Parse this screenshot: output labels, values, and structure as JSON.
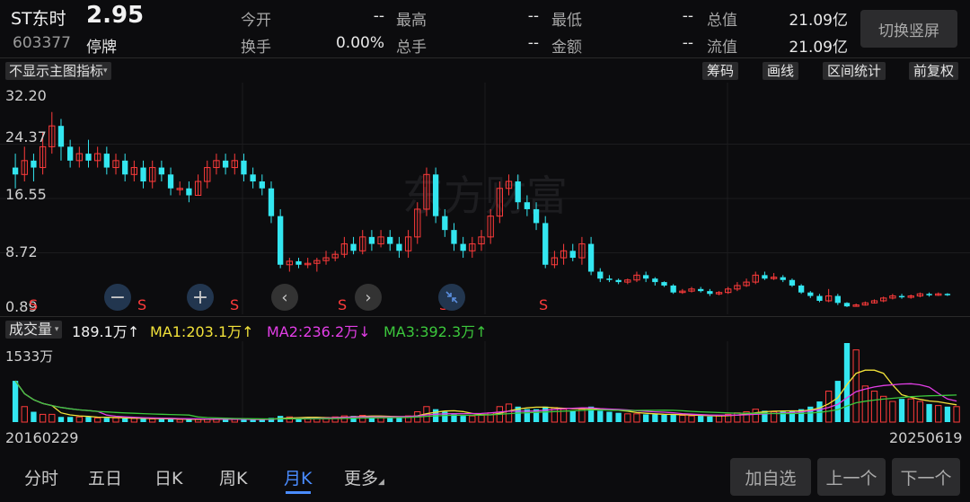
{
  "stock": {
    "name": "ST东时",
    "price": "2.95",
    "code": "603377",
    "status": "停牌"
  },
  "quote": [
    {
      "label": "今开",
      "value": "--"
    },
    {
      "label": "最高",
      "value": "--"
    },
    {
      "label": "最低",
      "value": "--"
    },
    {
      "label": "总值",
      "value": "21.09亿"
    },
    {
      "label": "换手",
      "value": "0.00%"
    },
    {
      "label": "总手",
      "value": "--"
    },
    {
      "label": "金额",
      "value": "--"
    },
    {
      "label": "流值",
      "value": "21.09亿"
    }
  ],
  "switch_vertical": "切换竖屏",
  "toolbar": {
    "main_indicator": "不显示主图指标",
    "chips": "筹码",
    "draw": "画线",
    "range_stats": "区间统计",
    "adjust": "前复权"
  },
  "price_axis": [
    "32.20",
    "24.37",
    "16.55",
    "8.72",
    "0.89"
  ],
  "watermark": "东方财富",
  "markers": [
    "S",
    "S",
    "S",
    "S",
    "S",
    "S"
  ],
  "volume": {
    "indicator": "成交量",
    "current": "189.1万",
    "ma1": "MA1:203.1万",
    "ma2": "MA2:236.2万",
    "ma3": "MA3:392.3万",
    "arrow_up": "↑",
    "arrow_down": "↓",
    "max_label": "1533万"
  },
  "dates": {
    "start": "20160229",
    "end": "20250619"
  },
  "nav": [
    "分时",
    "五日",
    "日K",
    "周K",
    "月K",
    "更多"
  ],
  "nav_active_index": 4,
  "bottom_buttons": {
    "add": "加自选",
    "prev": "上一个",
    "next": "下一个"
  },
  "colors": {
    "up": "#ff3b3b",
    "down": "#33e6f0",
    "ma1": "#f2e23a",
    "ma2": "#e23ee6",
    "ma3": "#3cc83c",
    "accent": "#4a8cff"
  },
  "chart_data": {
    "type": "candlestick",
    "y_axis_ticks": [
      "32.20",
      "24.37",
      "16.55",
      "8.72",
      "0.89"
    ],
    "ylim": [
      0.89,
      32.2
    ],
    "x_range": [
      "20160229",
      "20250619"
    ],
    "volume_max": "1533万",
    "candles": [
      [
        21,
        20,
        23,
        18
      ],
      [
        20,
        22,
        24,
        19
      ],
      [
        22,
        21,
        23,
        19
      ],
      [
        21,
        24,
        26,
        20
      ],
      [
        24,
        27,
        29,
        23
      ],
      [
        27,
        24,
        28,
        22
      ],
      [
        24,
        22,
        25,
        21
      ],
      [
        22,
        23,
        24,
        21
      ],
      [
        23,
        22,
        25,
        21
      ],
      [
        22,
        23,
        24,
        21
      ],
      [
        23,
        21,
        24,
        20
      ],
      [
        21,
        22,
        23,
        20
      ],
      [
        22,
        20,
        23,
        19
      ],
      [
        20,
        21,
        22,
        19
      ],
      [
        21,
        19,
        22,
        18
      ],
      [
        19,
        21,
        22,
        18
      ],
      [
        21,
        20,
        22,
        19
      ],
      [
        20,
        18,
        21,
        17
      ],
      [
        18,
        18,
        19,
        17
      ],
      [
        18,
        17,
        19,
        16
      ],
      [
        17,
        19,
        20,
        17
      ],
      [
        19,
        21,
        22,
        18
      ],
      [
        21,
        22,
        23,
        20
      ],
      [
        22,
        21,
        23,
        20
      ],
      [
        21,
        22,
        23,
        20
      ],
      [
        22,
        20,
        23,
        19
      ],
      [
        20,
        19,
        21,
        18
      ],
      [
        19,
        18,
        20,
        17
      ],
      [
        18,
        14,
        19,
        13
      ],
      [
        14,
        7,
        15,
        6.5
      ],
      [
        7,
        7.5,
        8,
        6
      ],
      [
        7.5,
        7,
        8,
        6.5
      ],
      [
        7,
        7.2,
        8,
        6.5
      ],
      [
        7.2,
        7.6,
        8,
        6
      ],
      [
        7.6,
        8,
        9,
        7
      ],
      [
        8,
        8.5,
        9,
        7.5
      ],
      [
        8.5,
        10,
        11,
        8
      ],
      [
        10,
        9,
        11,
        8.5
      ],
      [
        9,
        11,
        12,
        8.5
      ],
      [
        11,
        10,
        12,
        9
      ],
      [
        10,
        11,
        12,
        9.5
      ],
      [
        11,
        10,
        12,
        9
      ],
      [
        10,
        9,
        11,
        8
      ],
      [
        9,
        11,
        12,
        8
      ],
      [
        11,
        15,
        16,
        10
      ],
      [
        15,
        20,
        21,
        14
      ],
      [
        20,
        14,
        21,
        13
      ],
      [
        14,
        12,
        15,
        11
      ],
      [
        12,
        10,
        13,
        9
      ],
      [
        10,
        9,
        11,
        8
      ],
      [
        9,
        10,
        11,
        8
      ],
      [
        10,
        11,
        12,
        9
      ],
      [
        11,
        14,
        15,
        10
      ],
      [
        14,
        18,
        19,
        13
      ],
      [
        18,
        19,
        20,
        17
      ],
      [
        19,
        16,
        20,
        15
      ],
      [
        16,
        15,
        17,
        14
      ],
      [
        15,
        13,
        16,
        12
      ],
      [
        13,
        7,
        14,
        6.5
      ],
      [
        7,
        8,
        9,
        6.5
      ],
      [
        8,
        9,
        10,
        7
      ],
      [
        9,
        8,
        10,
        7.5
      ],
      [
        8,
        10,
        11,
        7
      ],
      [
        10,
        6,
        11,
        5.5
      ],
      [
        6,
        5,
        6.5,
        4.5
      ],
      [
        5,
        4.8,
        5.5,
        4.5
      ],
      [
        4.8,
        4.5,
        5,
        4.2
      ],
      [
        4.5,
        4.8,
        5,
        4.2
      ],
      [
        4.8,
        5.5,
        6,
        4.5
      ],
      [
        5.5,
        5,
        6,
        4.5
      ],
      [
        5,
        4.5,
        5.2,
        4
      ],
      [
        4.5,
        4,
        4.6,
        3.8
      ],
      [
        4,
        3,
        4.2,
        2.8
      ],
      [
        3,
        3.2,
        3.5,
        2.8
      ],
      [
        3.2,
        3.5,
        3.8,
        3
      ],
      [
        3.5,
        3.2,
        3.8,
        3
      ],
      [
        3.2,
        2.8,
        3.5,
        2.5
      ],
      [
        2.8,
        3,
        3.2,
        2.6
      ],
      [
        3,
        3.5,
        3.8,
        2.8
      ],
      [
        3.5,
        4,
        4.5,
        3.2
      ],
      [
        4,
        4.5,
        5,
        3.8
      ],
      [
        4.5,
        5.5,
        6,
        4.2
      ],
      [
        5.5,
        5,
        6,
        4.8
      ],
      [
        5,
        5.2,
        5.8,
        4.8
      ],
      [
        5.2,
        4.8,
        5.5,
        4.5
      ],
      [
        4.8,
        4,
        5,
        3.8
      ],
      [
        4,
        3,
        4.2,
        2.8
      ],
      [
        3,
        2.5,
        3.2,
        2.2
      ],
      [
        2.5,
        1.8,
        2.8,
        1.6
      ],
      [
        1.8,
        2.5,
        3.5,
        1.6
      ],
      [
        2.5,
        1.5,
        2.8,
        1.2
      ],
      [
        1.5,
        1,
        1.6,
        0.9
      ],
      [
        1,
        1.2,
        1.4,
        0.95
      ],
      [
        1.2,
        1.5,
        1.7,
        1.1
      ],
      [
        1.5,
        1.8,
        2,
        1.4
      ],
      [
        1.8,
        2.2,
        2.4,
        1.6
      ],
      [
        2.2,
        2.5,
        2.8,
        2
      ],
      [
        2.5,
        2.3,
        2.8,
        2.1
      ],
      [
        2.3,
        2.5,
        2.7,
        2.1
      ],
      [
        2.5,
        2.8,
        3,
        2.3
      ],
      [
        2.8,
        2.6,
        3,
        2.4
      ],
      [
        2.6,
        2.8,
        3,
        2.5
      ],
      [
        2.8,
        2.7,
        2.9,
        2.5
      ]
    ],
    "volumes": [
      8,
      3,
      2,
      1.5,
      1.5,
      1,
      1,
      1,
      1,
      0.8,
      0.8,
      0.8,
      0.7,
      0.7,
      0.7,
      0.6,
      0.6,
      0.6,
      0.5,
      0.5,
      0.5,
      0.6,
      0.6,
      0.5,
      0.5,
      0.5,
      0.5,
      0.5,
      0.8,
      1.2,
      1,
      0.8,
      0.8,
      0.8,
      0.9,
      1,
      1.2,
      1.2,
      1.3,
      1.1,
      1,
      1,
      0.9,
      1.2,
      2,
      3,
      2.5,
      2,
      1.5,
      1.2,
      1.2,
      1.3,
      1.8,
      3,
      3.5,
      3,
      2.5,
      2.5,
      3,
      2.8,
      2.5,
      2.2,
      2.5,
      3,
      2.2,
      2,
      1.8,
      1.6,
      1.6,
      1.5,
      1.5,
      1.4,
      1.4,
      1.3,
      1.2,
      1.2,
      1.1,
      1.2,
      1.5,
      1.8,
      2,
      2.5,
      2.2,
      2,
      2,
      2.2,
      2.5,
      3,
      4,
      6,
      8,
      15.33,
      14,
      7,
      6,
      5,
      4,
      4.5,
      4.5,
      4,
      3.5,
      3.2,
      3,
      3
    ]
  }
}
